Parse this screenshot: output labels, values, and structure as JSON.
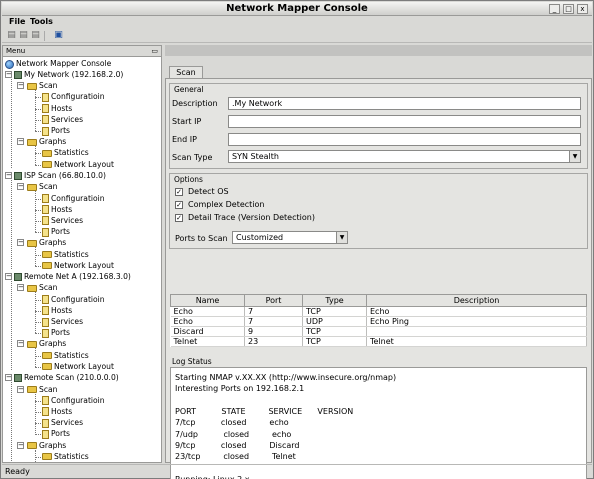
{
  "window": {
    "title": "Network Mapper Console"
  },
  "menu": {
    "file": "File",
    "tools": "Tools"
  },
  "toolbar": {
    "icons": [
      "new-icon",
      "open-icon",
      "close-icon",
      "save-icon"
    ]
  },
  "sidebar": {
    "header": "Menu",
    "root": "Network Mapper Console",
    "networks": [
      {
        "label": "My Network (192.168.2.0)"
      },
      {
        "label": "ISP Scan (66.80.10.0)"
      },
      {
        "label": "Remote Net A (192.168.3.0)"
      },
      {
        "label": "Remote Scan (210.0.0.0)"
      }
    ],
    "scan_label": "Scan",
    "scan_items": [
      "Configuratioin",
      "Hosts",
      "Services",
      "Ports"
    ],
    "graphs_label": "Graphs",
    "graph_items": [
      "Statistics",
      "Network Layout"
    ]
  },
  "tab": {
    "label": "Scan"
  },
  "general": {
    "title": "General",
    "description_label": "Description",
    "description_value": ".My Network",
    "start_ip_label": "Start IP",
    "start_ip_value": "",
    "end_ip_label": "End IP",
    "end_ip_value": "",
    "scan_type_label": "Scan Type",
    "scan_type_value": "SYN Stealth"
  },
  "options": {
    "title": "Options",
    "detect_os": "Detect OS",
    "complex_detection": "Complex Detection",
    "detail_trace": "Detail Trace (Version Detection)",
    "ports_to_scan_label": "Ports to Scan",
    "ports_to_scan_value": "Customized"
  },
  "ports_table": {
    "columns": [
      "Name",
      "Port",
      "Type",
      "Description"
    ],
    "rows": [
      [
        "Echo",
        "7",
        "TCP",
        "Echo"
      ],
      [
        "Echo",
        "7",
        "UDP",
        "Echo Ping"
      ],
      [
        "Discard",
        "9",
        "TCP",
        ""
      ],
      [
        "Telnet",
        "23",
        "TCP",
        "Telnet"
      ]
    ]
  },
  "log": {
    "title": "Log Status",
    "lines": [
      "Starting NMAP v.XX.XX (http://www.insecure.org/nmap)",
      "Interesting Ports on 192.168.2.1",
      "",
      "PORT          STATE         SERVICE      VERSION",
      "7/tcp          closed         echo",
      "7/udp          closed         echo",
      "9/tcp          closed         Discard",
      "23/tcp         closed         Telnet",
      "",
      "Running: Linux 2.x"
    ]
  },
  "status": {
    "text": "Ready"
  }
}
